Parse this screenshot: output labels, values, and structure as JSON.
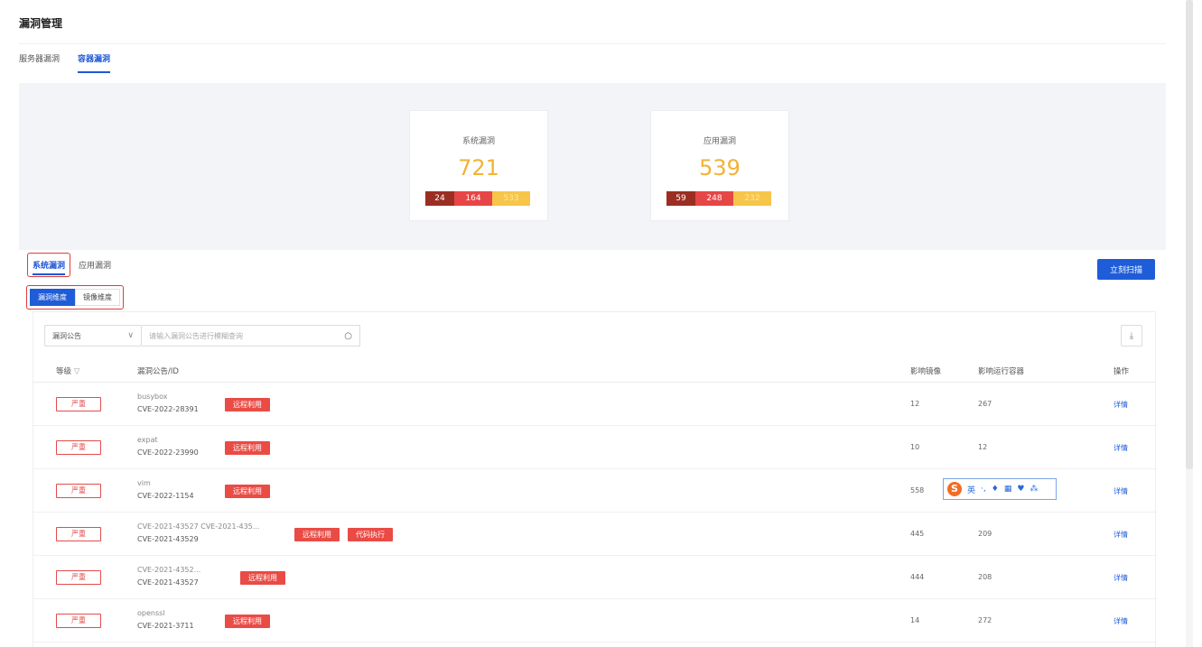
{
  "page_title": "漏洞管理",
  "top_tabs": [
    {
      "label": "服务器漏洞",
      "active": false
    },
    {
      "label": "容器漏洞",
      "active": true
    }
  ],
  "summary": {
    "system": {
      "label": "系统漏洞",
      "total": "721",
      "counts": [
        "24",
        "164",
        "533"
      ]
    },
    "application": {
      "label": "应用漏洞",
      "total": "539",
      "counts": [
        "59",
        "248",
        "232"
      ]
    }
  },
  "colors": {
    "critical": "#9b2e22",
    "high": "#e64646",
    "medium": "#f7c54a",
    "accent": "#1f5cd8",
    "total": "#f2b233"
  },
  "sub_tabs": [
    {
      "label": "系统漏洞",
      "active": true
    },
    {
      "label": "应用漏洞",
      "active": false
    }
  ],
  "scan_button": "立刻扫描",
  "dimension_buttons": [
    {
      "label": "漏洞维度",
      "active": true
    },
    {
      "label": "镜像维度",
      "active": false
    }
  ],
  "filter": {
    "select_value": "漏洞公告",
    "search_placeholder": "请输入漏洞公告进行模糊查询"
  },
  "table": {
    "headers": {
      "level": "等级",
      "notice": "漏洞公告/ID",
      "images": "影响镜像",
      "containers": "影响运行容器",
      "action": "操作"
    },
    "rows": [
      {
        "level": "严重",
        "line1": "busybox",
        "line2": "CVE-2022-28391",
        "tags": [
          "远程利用"
        ],
        "images": "12",
        "containers": "267",
        "action": "详情"
      },
      {
        "level": "严重",
        "line1": "expat",
        "line2": "CVE-2022-23990",
        "tags": [
          "远程利用"
        ],
        "images": "10",
        "containers": "12",
        "action": "详情"
      },
      {
        "level": "严重",
        "line1": "vim",
        "line2": "CVE-2022-1154",
        "tags": [
          "远程利用"
        ],
        "images": "558",
        "containers": "",
        "action": "详情"
      },
      {
        "level": "严重",
        "line1": "CVE-2021-43527 CVE-2021-435...",
        "line2": "CVE-2021-43529",
        "tags": [
          "远程利用",
          "代码执行"
        ],
        "images": "445",
        "containers": "209",
        "action": "详情"
      },
      {
        "level": "严重",
        "line1": "CVE-2021-4352...",
        "line2": "CVE-2021-43527",
        "tags": [
          "远程利用"
        ],
        "images": "444",
        "containers": "208",
        "action": "详情"
      },
      {
        "level": "严重",
        "line1": "openssl",
        "line2": "CVE-2021-3711",
        "tags": [
          "远程利用"
        ],
        "images": "14",
        "containers": "272",
        "action": "详情"
      }
    ]
  },
  "ime_toolbar": {
    "logo": "S",
    "items": [
      "英",
      "·,",
      "♦",
      "▦",
      "♥",
      "⁂"
    ]
  }
}
